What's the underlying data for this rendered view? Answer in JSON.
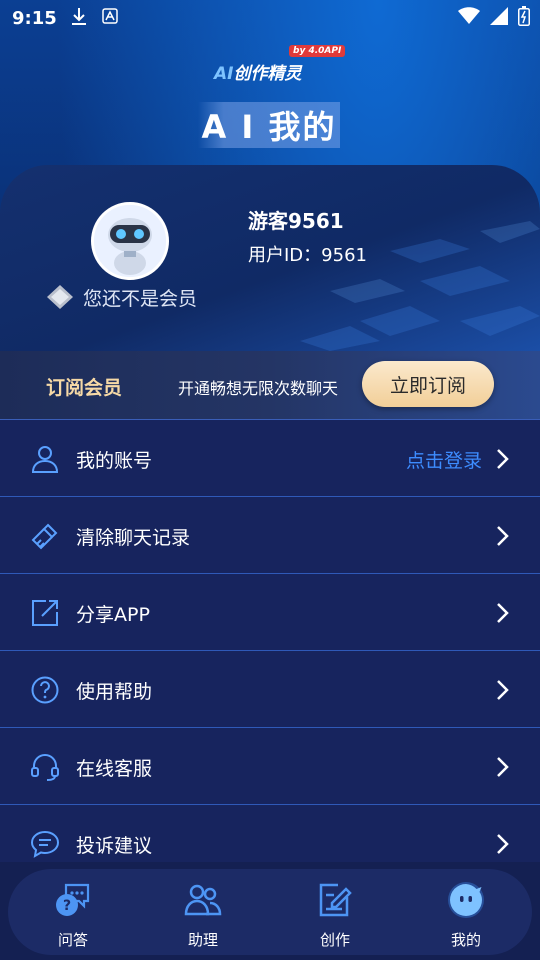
{
  "status_bar": {
    "time": "9:15"
  },
  "brand": {
    "badge": "by 4.0API",
    "ai": "AI",
    "name": "创作精灵"
  },
  "page_title": "A I 我的",
  "profile": {
    "username": "游客9561",
    "user_id": "用户ID：9561",
    "member_status": "您还不是会员"
  },
  "subscribe": {
    "title": "订阅会员",
    "description": "开通畅想无限次数聊天",
    "button": "立即订阅"
  },
  "menu": [
    {
      "label": "我的账号",
      "action": "点击登录",
      "icon": "user-icon"
    },
    {
      "label": "清除聊天记录",
      "action": "",
      "icon": "broom-icon"
    },
    {
      "label": "分享APP",
      "action": "",
      "icon": "share-icon"
    },
    {
      "label": "使用帮助",
      "action": "",
      "icon": "help-icon"
    },
    {
      "label": "在线客服",
      "action": "",
      "icon": "headset-icon"
    },
    {
      "label": "投诉建议",
      "action": "",
      "icon": "feedback-icon"
    }
  ],
  "nav": [
    {
      "label": "问答",
      "icon": "chat-question-icon",
      "active": false
    },
    {
      "label": "助理",
      "icon": "assistant-icon",
      "active": false
    },
    {
      "label": "创作",
      "icon": "edit-icon",
      "active": false
    },
    {
      "label": "我的",
      "icon": "mine-bot-icon",
      "active": true
    }
  ],
  "colors": {
    "accent": "#3d8cff",
    "gold": "#f6d9a6",
    "background": "#0a2a6a"
  }
}
